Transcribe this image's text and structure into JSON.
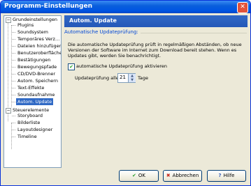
{
  "window": {
    "title": "Programm-Einstellungen"
  },
  "colors": {
    "titlebar": "#0054e3",
    "header": "#2458b8",
    "selection": "#316ac5",
    "group_label": "#0046d5"
  },
  "tree": {
    "groups": [
      {
        "label": "Grundeinstellungen",
        "expanded": true,
        "items": [
          "Plugins",
          "Soundsystem",
          "Temporäres Verz…",
          "Dateien hinzufügen",
          "Benutzeroberfläche",
          "Bestätigungen",
          "Bewegungspfade",
          "CD/DVD-Brenner",
          "Autom. Speichern",
          "Text-Effekte",
          "Soundaufnahme",
          "Autom. Update"
        ]
      },
      {
        "label": "Steuerelemente",
        "expanded": true,
        "items": [
          "Storyboard",
          "Bilderliste",
          "Layoutdesigner",
          "Timeline"
        ]
      }
    ],
    "selected": "Autom. Update"
  },
  "panel": {
    "title": "Autom. Update",
    "group_label": "Automatische Updateprüfung:",
    "description": "Die automatische Updateprüfung prüft in regelmäßigen Abständen, ob neue Versionen der Software im Internet zum Download bereit stehen. Wenn es Updates gibt, werden Sie benachrichtigt.",
    "checkbox_label": "automatische Updateprüfung aktivieren",
    "checkbox_checked": true,
    "interval_label": "Updateprüfung alle:",
    "interval_value": "21",
    "interval_unit": "Tage"
  },
  "buttons": {
    "ok": "OK",
    "cancel": "Abbrechen",
    "help": "Hilfe"
  }
}
